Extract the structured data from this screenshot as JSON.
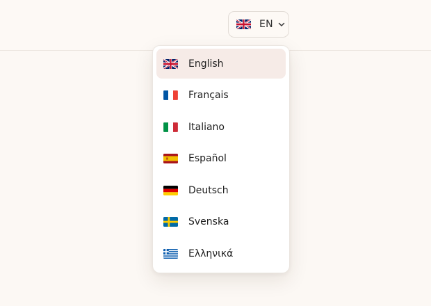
{
  "language_selector": {
    "current_code": "EN",
    "current_flag": "flag-uk-icon",
    "chevron_icon": "chevron-down-icon"
  },
  "menu": {
    "items": [
      {
        "label": "English",
        "flag": "flag-uk-icon",
        "selected": true
      },
      {
        "label": "Français",
        "flag": "flag-france-icon",
        "selected": false
      },
      {
        "label": "Italiano",
        "flag": "flag-italy-icon",
        "selected": false
      },
      {
        "label": "Español",
        "flag": "flag-spain-icon",
        "selected": false
      },
      {
        "label": "Deutsch",
        "flag": "flag-germany-icon",
        "selected": false
      },
      {
        "label": "Svenska",
        "flag": "flag-sweden-icon",
        "selected": false
      },
      {
        "label": "Ελληνικά",
        "flag": "flag-greece-icon",
        "selected": false
      }
    ]
  },
  "colors": {
    "page_background": "#fcf8f4",
    "selected_item_background": "#f6ebe7",
    "menu_background": "#ffffff",
    "text": "#1e1e1e"
  }
}
